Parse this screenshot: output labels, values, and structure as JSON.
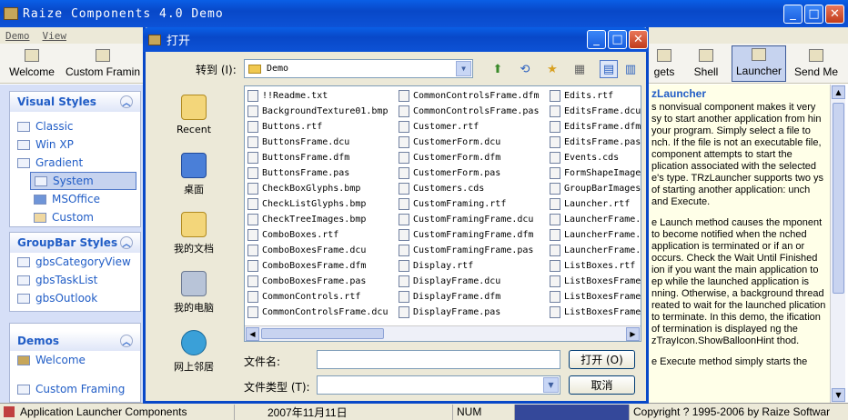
{
  "app": {
    "title": "Raize Components 4.0 Demo",
    "menu": [
      "Demo",
      "View"
    ],
    "window_buttons": {
      "minimize": "_",
      "maximize": "□",
      "close": "✕"
    }
  },
  "toolbar": {
    "items": [
      {
        "label": "Welcome",
        "icon": "grid-icon"
      },
      {
        "label": "Custom Framin",
        "icon": "frame-icon"
      },
      {
        "label": "gets",
        "icon": "widget-icon"
      },
      {
        "label": "Shell",
        "icon": "folder-icon"
      },
      {
        "label": "Launcher",
        "icon": "launcher-icon",
        "active": true
      },
      {
        "label": "Send Me",
        "icon": "message-icon"
      }
    ]
  },
  "sidebar": {
    "visual_styles": {
      "title": "Visual Styles",
      "items": [
        "Classic",
        "Win XP",
        "Gradient"
      ],
      "sub_items": [
        "System",
        "MSOffice",
        "Custom"
      ],
      "selected": "System"
    },
    "groupbar_styles": {
      "title": "GroupBar Styles",
      "items": [
        "gbsCategoryView",
        "gbsTaskList",
        "gbsOutlook"
      ]
    },
    "demos": {
      "title": "Demos",
      "items": [
        "Welcome",
        "Custom Framing"
      ]
    }
  },
  "description": {
    "heading": "zLauncher",
    "p1": "s nonvisual component makes it very sy to start another application from hin your program. Simply select a file to nch. If the file is not an executable file, component attempts to start the plication associated with the selected e's type. TRzLauncher supports two ys of starting another application: unch and Execute.",
    "p2": "e Launch method causes the mponent to become notified when the nched application is terminated or if an or occurs.  Check the Wait Until Finished ion if you want the main application to ep while the launched application is nning. Otherwise, a background thread reated to wait for the launched plication to terminate. In this demo, the ification of termination is displayed ng the zTrayIcon.ShowBalloonHint thod.",
    "p3": "e Execute method simply starts the"
  },
  "statusbar": {
    "component": "Application Launcher Components",
    "date": "2007年11月11日",
    "num": "NUM",
    "copyright": "Copyright ? 1995-2006 by Raize Softwar"
  },
  "dialog": {
    "title": "打开",
    "look_in_label": "转到 (I):",
    "look_in_value": "Demo",
    "places": [
      "Recent",
      "桌面",
      "我的文档",
      "我的电脑",
      "网上邻居"
    ],
    "files_col1": [
      "!!Readme.txt",
      "BackgroundTexture01.bmp",
      "Buttons.rtf",
      "ButtonsFrame.dcu",
      "ButtonsFrame.dfm",
      "ButtonsFrame.pas",
      "CheckBoxGlyphs.bmp",
      "CheckListGlyphs.bmp",
      "CheckTreeImages.bmp",
      "ComboBoxes.rtf",
      "ComboBoxesFrame.dcu",
      "ComboBoxesFrame.dfm",
      "ComboBoxesFrame.pas",
      "CommonControls.rtf",
      "CommonControlsFrame.dcu"
    ],
    "files_col2": [
      "CommonControlsFrame.dfm",
      "CommonControlsFrame.pas",
      "Customer.rtf",
      "CustomerForm.dcu",
      "CustomerForm.dfm",
      "CustomerForm.pas",
      "Customers.cds",
      "CustomFraming.rtf",
      "CustomFramingFrame.dcu",
      "CustomFramingFrame.dfm",
      "CustomFramingFrame.pas",
      "Display.rtf",
      "DisplayFrame.dcu",
      "DisplayFrame.dfm",
      "DisplayFrame.pas"
    ],
    "files_col3": [
      "Edits.rtf",
      "EditsFrame.dcu",
      "EditsFrame.dfm",
      "EditsFrame.pas",
      "Events.cds",
      "FormShapeImage",
      "GroupBarImages",
      "Launcher.rtf",
      "LauncherFrame.",
      "LauncherFrame.",
      "LauncherFrame.",
      "ListBoxes.rtf",
      "ListBoxesFrame",
      "ListBoxesFrame",
      "ListBoxesFrame"
    ],
    "filename_label": "文件名:",
    "filename_value": "",
    "filetype_label": "文件类型 (T):",
    "filetype_value": "",
    "open_button": "打开 (O)",
    "cancel_button": "取消"
  }
}
